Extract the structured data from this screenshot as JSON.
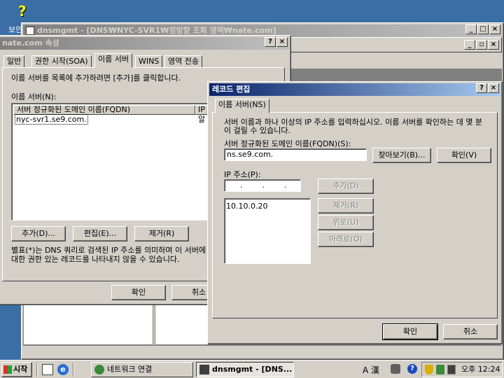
{
  "desktop": {
    "icon_label": "보안 이"
  },
  "mmc": {
    "title": "dnsmgmt - [DNS₩NYC-SVR1₩정방향 조회 영역₩nate.com]"
  },
  "props": {
    "title": "nate.com 속성",
    "tabs": [
      "일반",
      "권한 시작(SOA)",
      "이름 서버",
      "WINS",
      "영역 전송"
    ],
    "instruction": "이름 서버를 목록에 추가하려면 [추가]를 클릭합니다.",
    "list_label": "이름 서버(N):",
    "col_fqdn": "서버 정규화된 도메인 이름(FQDN)",
    "col_ip": "IP",
    "row_fqdn": "nyc-svr1.se9.com.",
    "row_ip": "알",
    "add_button": "추가(D)...",
    "edit_button": "편집(E)...",
    "remove_button": "제거(R)",
    "note": "별표(*)는 DNS 쿼리로 검색된 IP 주소를 의미하며 이 서버에 대한 권한 있는 레코드를 나타내지 않을 수 있습니다.",
    "ok_button": "확인",
    "cancel_button": "취소"
  },
  "edit": {
    "title": "레코드 편집",
    "tab": "이름 서버(NS)",
    "description": "서버 이름과 하나 이상의 IP 주소를 입력하십시오. 이름 서버를 확인하는 데 몇 분이 걸릴 수 있습니다.",
    "fqdn_label": "서버 정규화된 도메인 이름(FQDN)(S):",
    "fqdn_value": "ns.se9.com.",
    "browse_button": "찾아보기(B)...",
    "resolve_button": "확인(V)",
    "ip_label": "IP 주소(P):",
    "ip_dots": ".        .        .",
    "ip_list": [
      "10.10.0.20"
    ],
    "add_button": "추가(D)",
    "remove_button": "제거(R)",
    "up_button": "위로(U)",
    "down_button": "아래로(O)",
    "ok_button": "확인",
    "cancel_button": "취소"
  },
  "taskbar": {
    "start": "시작",
    "task1": "네트워크 연결",
    "task2": "dnsmgmt - [DNS...",
    "ime": "A 漢",
    "clock": "오후 12:24"
  }
}
